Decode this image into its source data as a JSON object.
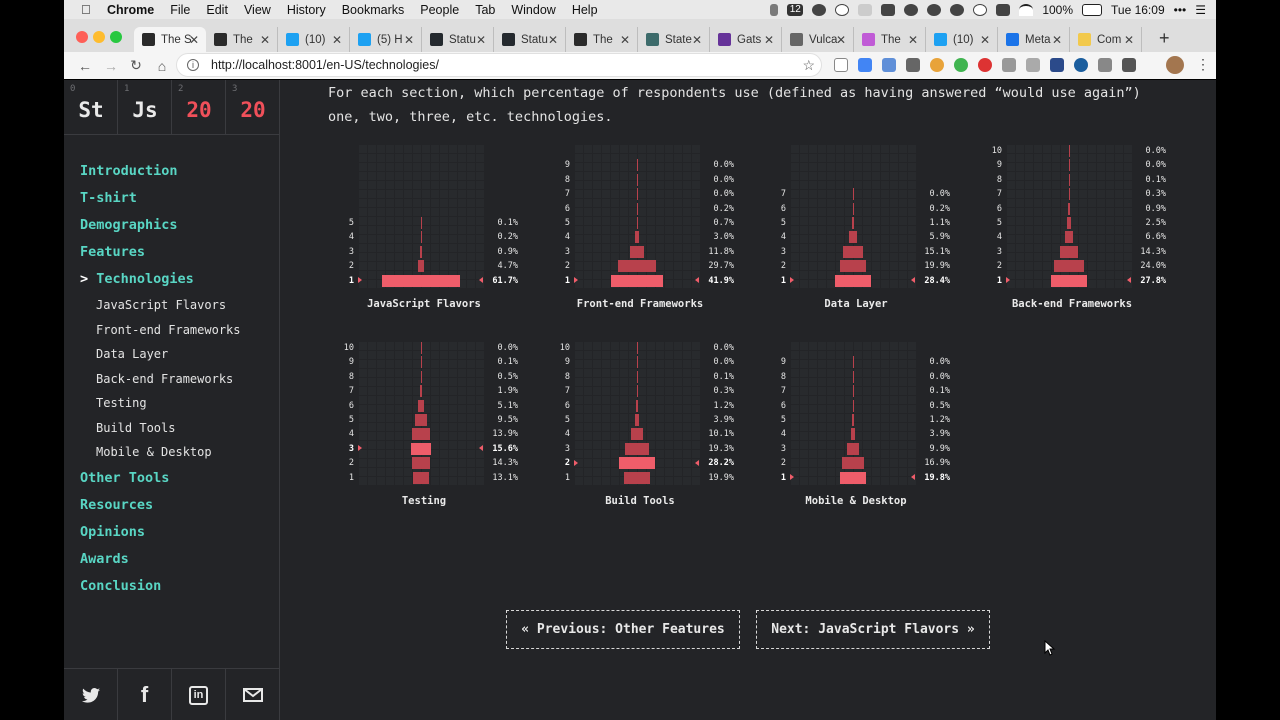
{
  "menubar": {
    "items": [
      "Chrome",
      "File",
      "Edit",
      "View",
      "History",
      "Bookmarks",
      "People",
      "Tab",
      "Window",
      "Help"
    ],
    "badge": "12",
    "battery": "100%",
    "clock": "Tue 16:09"
  },
  "browser": {
    "tabs": [
      {
        "title": "The S",
        "icon": "js-icon",
        "color": "#2b2b2b"
      },
      {
        "title": "The",
        "icon": "js-icon",
        "color": "#2b2b2b"
      },
      {
        "title": "(10)",
        "icon": "twitter-icon",
        "color": "#1da1f2"
      },
      {
        "title": "(5) H",
        "icon": "twitter-icon",
        "color": "#1da1f2"
      },
      {
        "title": "Statu",
        "icon": "github-icon",
        "color": "#24292e"
      },
      {
        "title": "Statu",
        "icon": "github-icon",
        "color": "#24292e"
      },
      {
        "title": "The",
        "icon": "js-icon",
        "color": "#2b2b2b"
      },
      {
        "title": "State",
        "icon": "grid-icon",
        "color": "#3d6b6b"
      },
      {
        "title": "Gats",
        "icon": "gatsby-icon",
        "color": "#663399"
      },
      {
        "title": "Vulca",
        "icon": "globe-icon",
        "color": "#666666"
      },
      {
        "title": "The",
        "icon": "triangle-icon",
        "color": "#c05bd6"
      },
      {
        "title": "(10)",
        "icon": "twitter-icon",
        "color": "#1da1f2"
      },
      {
        "title": "Meta",
        "icon": "browser-icon",
        "color": "#1a73e8"
      },
      {
        "title": "Com",
        "icon": "n-icon",
        "color": "#f2c94c"
      }
    ],
    "url": "http://localhost:8001/en-US/technologies/"
  },
  "logo": [
    {
      "num": "0",
      "text": "St",
      "accent": false
    },
    {
      "num": "1",
      "text": "Js",
      "accent": false
    },
    {
      "num": "2",
      "text": "20",
      "accent": true
    },
    {
      "num": "3",
      "text": "20",
      "accent": true
    }
  ],
  "nav": {
    "before": [
      "Introduction",
      "T-shirt",
      "Demographics",
      "Features"
    ],
    "active": "Technologies",
    "active_prefix": ">",
    "sub": [
      "JavaScript Flavors",
      "Front-end Frameworks",
      "Data Layer",
      "Back-end Frameworks",
      "Testing",
      "Build Tools",
      "Mobile & Desktop"
    ],
    "after": [
      "Other Tools",
      "Resources",
      "Opinions",
      "Awards",
      "Conclusion"
    ]
  },
  "social": [
    "twitter-icon",
    "facebook-icon",
    "linkedin-icon",
    "email-icon"
  ],
  "intro": "For each section, which percentage of respondents use (defined as having answered “would use again”) one, two, three, etc. technologies.",
  "colors": {
    "bar": "#ef5d6a",
    "bar_dim": "#b8414c",
    "accent": "#59d6c4"
  },
  "chart_data": [
    {
      "type": "bar",
      "title": "JavaScript Flavors",
      "categories": [
        "1",
        "2",
        "3",
        "4",
        "5"
      ],
      "values": [
        61.7,
        4.7,
        0.9,
        0.2,
        0.1
      ],
      "labels": [
        "61.7%",
        "4.7%",
        "0.9%",
        "0.2%",
        "0.1%"
      ],
      "highlight": "1"
    },
    {
      "type": "bar",
      "title": "Front-end Frameworks",
      "categories": [
        "1",
        "2",
        "3",
        "4",
        "5",
        "6",
        "7",
        "8",
        "9"
      ],
      "values": [
        41.9,
        29.7,
        11.8,
        3.0,
        0.7,
        0.2,
        0.0,
        0.0,
        0.0
      ],
      "labels": [
        "41.9%",
        "29.7%",
        "11.8%",
        "3.0%",
        "0.7%",
        "0.2%",
        "0.0%",
        "0.0%",
        "0.0%"
      ],
      "highlight": "1"
    },
    {
      "type": "bar",
      "title": "Data Layer",
      "categories": [
        "1",
        "2",
        "3",
        "4",
        "5",
        "6",
        "7"
      ],
      "values": [
        28.4,
        19.9,
        15.1,
        5.9,
        1.1,
        0.2,
        0.0
      ],
      "labels": [
        "28.4%",
        "19.9%",
        "15.1%",
        "5.9%",
        "1.1%",
        "0.2%",
        "0.0%"
      ],
      "highlight": "1"
    },
    {
      "type": "bar",
      "title": "Back-end Frameworks",
      "categories": [
        "1",
        "2",
        "3",
        "4",
        "5",
        "6",
        "7",
        "8",
        "9",
        "10"
      ],
      "values": [
        27.8,
        24.0,
        14.3,
        6.6,
        2.5,
        0.9,
        0.3,
        0.1,
        0.0,
        0.0
      ],
      "labels": [
        "27.8%",
        "24.0%",
        "14.3%",
        "6.6%",
        "2.5%",
        "0.9%",
        "0.3%",
        "0.1%",
        "0.0%",
        "0.0%"
      ],
      "highlight": "1"
    },
    {
      "type": "bar",
      "title": "Testing",
      "categories": [
        "1",
        "2",
        "3",
        "4",
        "5",
        "6",
        "7",
        "8",
        "9",
        "10"
      ],
      "values": [
        13.1,
        14.3,
        15.6,
        13.9,
        9.5,
        5.1,
        1.9,
        0.5,
        0.1,
        0.0
      ],
      "labels": [
        "13.1%",
        "14.3%",
        "15.6%",
        "13.9%",
        "9.5%",
        "5.1%",
        "1.9%",
        "0.5%",
        "0.1%",
        "0.0%"
      ],
      "highlight": "3"
    },
    {
      "type": "bar",
      "title": "Build Tools",
      "categories": [
        "1",
        "2",
        "3",
        "4",
        "5",
        "6",
        "7",
        "8",
        "9",
        "10"
      ],
      "values": [
        19.9,
        28.2,
        19.3,
        10.1,
        3.9,
        1.2,
        0.3,
        0.1,
        0.0,
        0.0
      ],
      "labels": [
        "19.9%",
        "28.2%",
        "19.3%",
        "10.1%",
        "3.9%",
        "1.2%",
        "0.3%",
        "0.1%",
        "0.0%",
        "0.0%"
      ],
      "highlight": "2"
    },
    {
      "type": "bar",
      "title": "Mobile & Desktop",
      "categories": [
        "1",
        "2",
        "3",
        "4",
        "5",
        "6",
        "7",
        "8",
        "9"
      ],
      "values": [
        19.8,
        16.9,
        9.9,
        3.9,
        1.2,
        0.5,
        0.1,
        0.0,
        0.0
      ],
      "labels": [
        "19.8%",
        "16.9%",
        "9.9%",
        "3.9%",
        "1.2%",
        "0.5%",
        "0.1%",
        "0.0%",
        "0.0%"
      ],
      "highlight": "1"
    }
  ],
  "pagination": {
    "previous": "« Previous: Other Features",
    "next": "Next: JavaScript Flavors »"
  }
}
